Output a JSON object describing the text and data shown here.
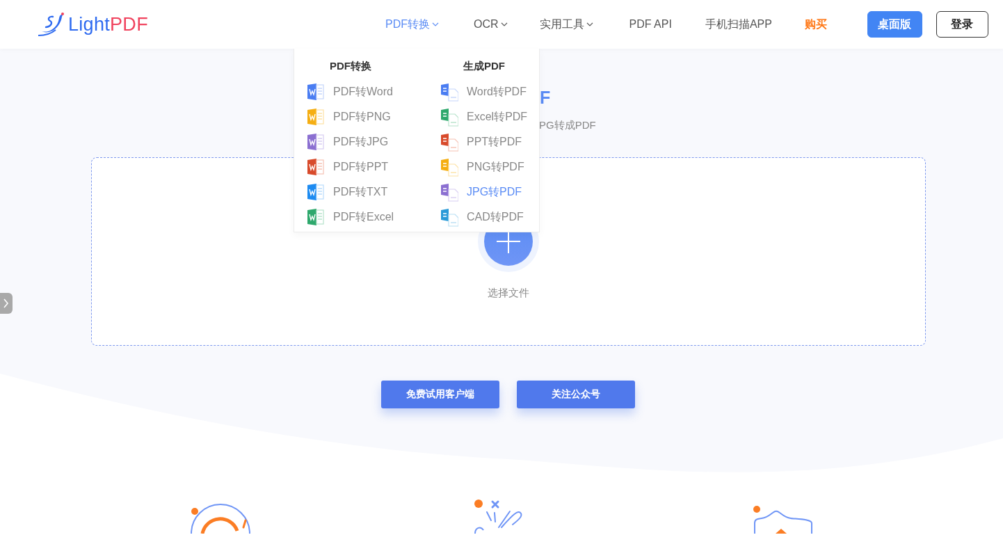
{
  "header": {
    "logo": {
      "text": "Light",
      "accent": "PDF"
    },
    "nav": [
      {
        "label": "PDF转换",
        "selected": true,
        "has_menu": true,
        "kind": "plain"
      },
      {
        "label": "OCR",
        "selected": false,
        "has_menu": true,
        "kind": "plain"
      },
      {
        "label": "实用工具",
        "selected": false,
        "has_menu": true,
        "kind": "plain"
      },
      {
        "label": "PDF API",
        "selected": false,
        "has_menu": false,
        "kind": "plain"
      },
      {
        "label": "手机扫描APP",
        "selected": false,
        "has_menu": false,
        "kind": "plain"
      },
      {
        "label": "购买",
        "selected": false,
        "has_menu": false,
        "kind": "accent"
      }
    ],
    "buttons": [
      {
        "label": "桌面版",
        "kind": "primary"
      },
      {
        "label": "登录",
        "kind": "outline"
      }
    ]
  },
  "hero": {
    "title": "F",
    "subtitle": "PG转成PDF"
  },
  "dropdown": {
    "columns": [
      {
        "heading": "PDF转换",
        "items": [
          {
            "label": "PDF转Word",
            "kind": "word",
            "selected": false
          },
          {
            "label": "PDF转PNG",
            "kind": "png",
            "selected": false
          },
          {
            "label": "PDF转JPG",
            "kind": "jpg",
            "selected": false
          },
          {
            "label": "PDF转PPT",
            "kind": "ppt",
            "selected": false
          },
          {
            "label": "PDF转TXT",
            "kind": "txt",
            "selected": false
          },
          {
            "label": "PDF转Excel",
            "kind": "excel",
            "selected": false
          }
        ]
      },
      {
        "heading": "生成PDF",
        "items": [
          {
            "label": "Word转PDF",
            "kind": "word",
            "selected": false
          },
          {
            "label": "Excel转PDF",
            "kind": "excel",
            "selected": false
          },
          {
            "label": "PPT转PDF",
            "kind": "ppt",
            "selected": false
          },
          {
            "label": "PNG转PDF",
            "kind": "png",
            "selected": false
          },
          {
            "label": "JPG转PDF",
            "kind": "jpg",
            "selected": true
          },
          {
            "label": "CAD转PDF",
            "kind": "cad",
            "selected": false
          }
        ]
      }
    ]
  },
  "upload": {
    "label": "选择文件"
  },
  "actions": [
    "免费试用客户端",
    "关注公众号"
  ]
}
